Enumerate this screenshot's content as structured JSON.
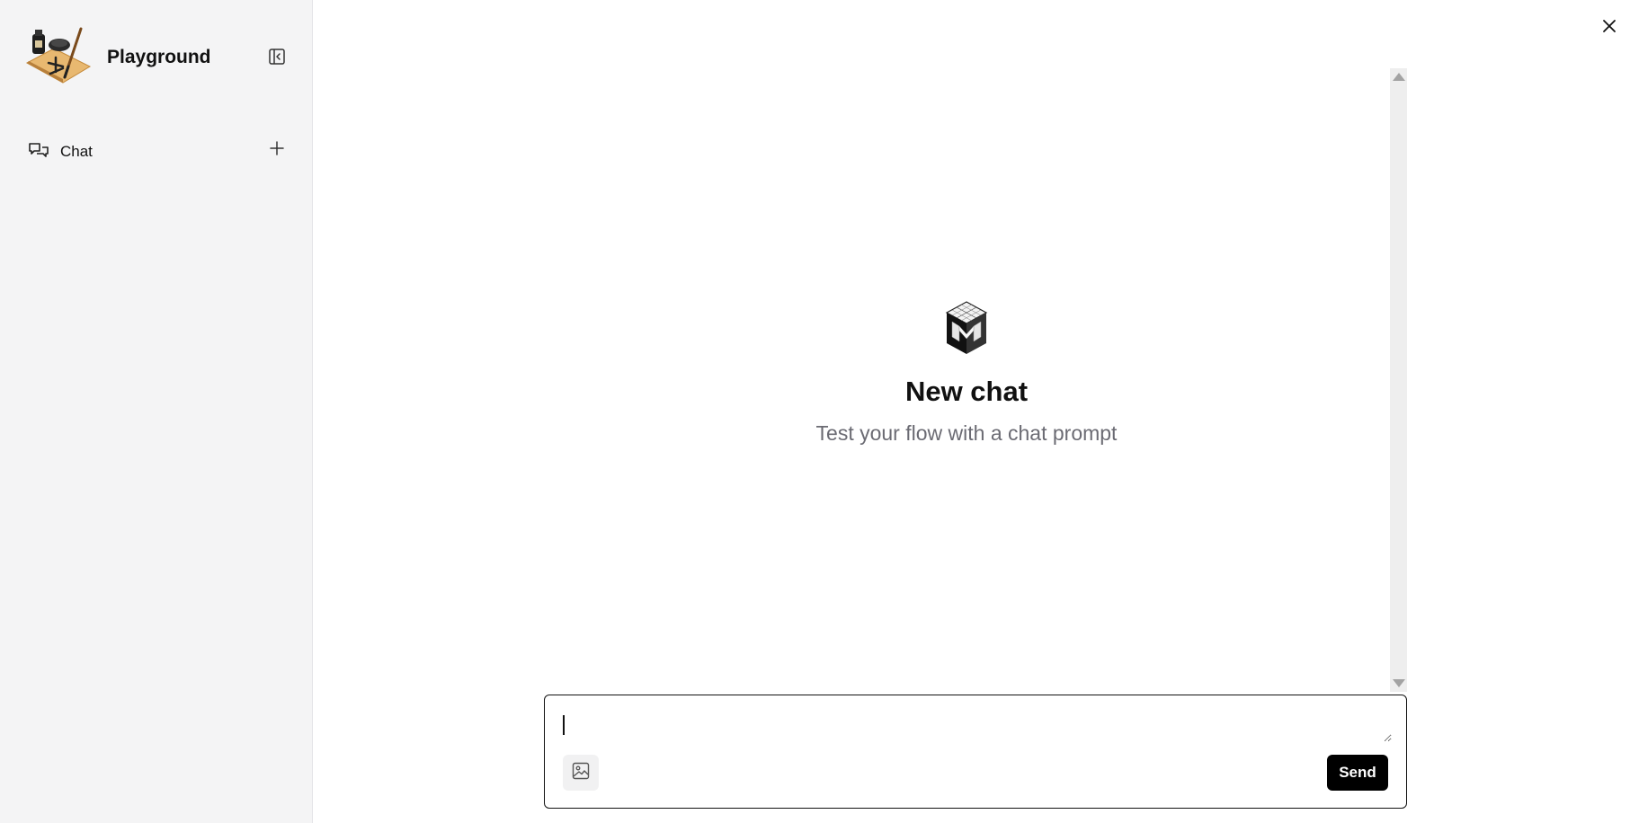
{
  "sidebar": {
    "app_title": "Playground",
    "logo_icon": "ink-brush-logo-icon",
    "collapse_icon": "sidebar-collapse-icon",
    "nav": {
      "chat_label": "Chat",
      "chat_icon": "chat-bubbles-icon",
      "add_icon": "plus-icon"
    }
  },
  "header": {
    "close_icon": "close-icon"
  },
  "main": {
    "empty_state": {
      "logo_icon": "cube-logo-icon",
      "title": "New chat",
      "subtitle": "Test your flow with a chat prompt"
    }
  },
  "composer": {
    "input_value": "",
    "placeholder": "",
    "image_icon": "image-upload-icon",
    "send_label": "Send"
  },
  "colors": {
    "sidebar_bg": "#f4f4f5",
    "send_bg": "#000000",
    "subtitle_text": "#6b6b73"
  }
}
